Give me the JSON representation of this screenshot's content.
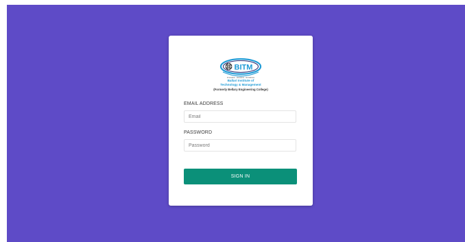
{
  "institution": {
    "logo_text": "BITM",
    "logo_tagline": "Innovation · Research · Excellence",
    "name_line1": "Ballari Institute of",
    "name_line2": "Technology & Management",
    "name_line3": "(Formerly Bellary Engineering College)"
  },
  "form": {
    "email_label": "EMAIL ADDRESS",
    "email_placeholder": "Email",
    "email_value": "",
    "password_label": "PASSWORD",
    "password_placeholder": "Password",
    "password_value": "",
    "submit_label": "SIGN IN"
  },
  "colors": {
    "background": "#5e4bc7",
    "card": "#ffffff",
    "button": "#0b9079",
    "logo_blue": "#1f9bd6"
  }
}
